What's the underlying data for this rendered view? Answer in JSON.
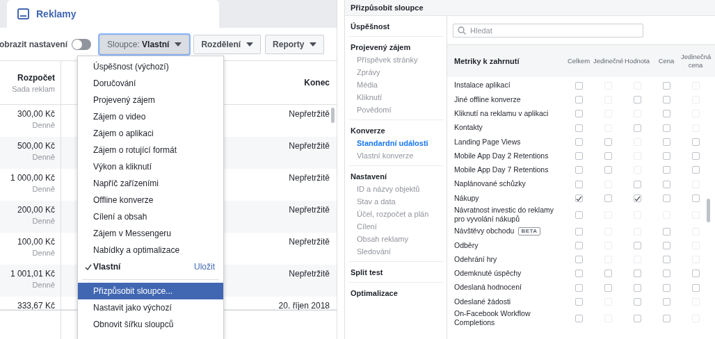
{
  "ads_panel": {
    "tab": {
      "label": "Reklamy"
    },
    "toolbar": {
      "settings_label": "obrazit nastavení",
      "settings_on": false,
      "buttons": [
        {
          "label": "Sloupce: **Vlastní**",
          "selected": true
        },
        {
          "label": "Rozdělení",
          "selected": false
        },
        {
          "label": "Reporty",
          "selected": false
        }
      ]
    },
    "table": {
      "columns": [
        {
          "title": "Rozpočet",
          "subtitle": "Sada reklam"
        },
        {
          "title": "Konec"
        }
      ],
      "rows": [
        {
          "budget": "300,00 Kč",
          "period": "Denně",
          "end": "Nepřetržitě"
        },
        {
          "budget": "500,00 Kč",
          "period": "Denně",
          "end": "Nepřetržitě"
        },
        {
          "budget": "1 000,00 Kč",
          "period": "Denně",
          "end": "Nepřetržitě"
        },
        {
          "budget": "200,00 Kč",
          "period": "Denně",
          "end": "Nepřetržitě"
        },
        {
          "budget": "100,00 Kč",
          "period": "Denně",
          "end": "Nepřetržitě"
        },
        {
          "budget": "1 001,01 Kč",
          "period": "Denně",
          "end": "Nepřetržitě"
        },
        {
          "budget": "333,67 Kč",
          "end": "20. říjen 2018"
        }
      ]
    },
    "menu": {
      "items": [
        {
          "kind": "preset",
          "label": "Úspěšnost (výchozí)",
          "checked": false,
          "selected": false
        },
        {
          "kind": "preset",
          "label": "Doručování",
          "checked": false,
          "selected": false
        },
        {
          "kind": "preset",
          "label": "Projevený zájem",
          "checked": false,
          "selected": false
        },
        {
          "kind": "preset",
          "label": "Zájem o video",
          "checked": false,
          "selected": false
        },
        {
          "kind": "preset",
          "label": "Zájem o aplikaci",
          "checked": false,
          "selected": false
        },
        {
          "kind": "preset",
          "label": "Zájem o rotující formát",
          "checked": false,
          "selected": false
        },
        {
          "kind": "preset",
          "label": "Výkon a kliknutí",
          "checked": false,
          "selected": false
        },
        {
          "kind": "preset",
          "label": "Napříč zařízeními",
          "checked": false,
          "selected": false
        },
        {
          "kind": "preset",
          "label": "Offline konverze",
          "checked": false,
          "selected": false
        },
        {
          "kind": "preset",
          "label": "Cílení a obsah",
          "checked": false,
          "selected": false
        },
        {
          "kind": "preset",
          "label": "Zájem v Messengeru",
          "checked": false,
          "selected": false
        },
        {
          "kind": "preset",
          "label": "Nabídky a optimalizace",
          "checked": false,
          "selected": false
        },
        {
          "kind": "custom",
          "label": "Vlastní",
          "action": "Uložit",
          "checked": true,
          "selected": false
        },
        {
          "kind": "action",
          "label": "Přizpůsobit sloupce...",
          "checked": false,
          "selected": true
        },
        {
          "kind": "action",
          "label": "Nastavit jako výchozí",
          "checked": false,
          "selected": false
        },
        {
          "kind": "action",
          "label": "Obnovit šířku sloupců",
          "checked": false,
          "selected": false
        }
      ]
    }
  },
  "dialog": {
    "title": "Přizpůsobit sloupce",
    "sidebar": [
      {
        "label": "Úspěšnost"
      },
      {
        "label": "Projevený zájem",
        "children": [
          {
            "label": "Příspěvek stránky",
            "selected": false
          },
          {
            "label": "Zprávy",
            "selected": false
          },
          {
            "label": "Média",
            "selected": false
          },
          {
            "label": "Kliknutí",
            "selected": false
          },
          {
            "label": "Povědomí",
            "selected": false
          }
        ]
      },
      {
        "label": "Konverze",
        "children": [
          {
            "label": "Standardní události",
            "selected": true
          },
          {
            "label": "Vlastní konverze",
            "selected": false
          }
        ]
      },
      {
        "label": "Nastavení",
        "children": [
          {
            "label": "ID a názvy objektů",
            "selected": false
          },
          {
            "label": "Stav a data",
            "selected": false
          },
          {
            "label": "Účel, rozpočet a plán",
            "selected": false
          },
          {
            "label": "Cílení",
            "selected": false
          },
          {
            "label": "Obsah reklamy",
            "selected": false
          },
          {
            "label": "Sledování",
            "selected": false
          }
        ]
      },
      {
        "label": "Split test"
      },
      {
        "label": "Optimalizace"
      }
    ],
    "search": {
      "placeholder": "Hledat"
    },
    "metrics": {
      "heading": "Metriky k zahrnutí",
      "columns": [
        "Celkem",
        "Jedinečné",
        "Hodnota",
        "Cena",
        "Jedinečná cena"
      ],
      "rows": [
        {
          "name": "Instalace aplikací",
          "cells": [
            {
              "checked": false,
              "disabled": false
            },
            {
              "checked": false,
              "disabled": true
            },
            {
              "checked": false,
              "disabled": true
            },
            {
              "checked": false,
              "disabled": false
            },
            {
              "checked": false,
              "disabled": true
            }
          ]
        },
        {
          "name": "Jiné offline konverze",
          "cells": [
            {
              "checked": false,
              "disabled": false
            },
            {
              "checked": false,
              "disabled": true
            },
            {
              "checked": false,
              "disabled": false
            },
            {
              "checked": false,
              "disabled": false
            },
            {
              "checked": false,
              "disabled": true
            }
          ]
        },
        {
          "name": "Kliknutí na reklamu v aplikaci",
          "cells": [
            {
              "checked": false,
              "disabled": false
            },
            {
              "checked": false,
              "disabled": true
            },
            {
              "checked": false,
              "disabled": true
            },
            {
              "checked": false,
              "disabled": false
            },
            {
              "checked": false,
              "disabled": true
            }
          ]
        },
        {
          "name": "Kontakty",
          "cells": [
            {
              "checked": false,
              "disabled": false
            },
            {
              "checked": false,
              "disabled": true
            },
            {
              "checked": false,
              "disabled": false
            },
            {
              "checked": false,
              "disabled": false
            },
            {
              "checked": false,
              "disabled": true
            }
          ]
        },
        {
          "name": "Landing Page Views",
          "cells": [
            {
              "checked": false,
              "disabled": false
            },
            {
              "checked": false,
              "disabled": false
            },
            {
              "checked": false,
              "disabled": true
            },
            {
              "checked": false,
              "disabled": false
            },
            {
              "checked": false,
              "disabled": false
            }
          ]
        },
        {
          "name": "Mobile App Day 2 Retentions",
          "cells": [
            {
              "checked": false,
              "disabled": false
            },
            {
              "checked": false,
              "disabled": false
            },
            {
              "checked": false,
              "disabled": true
            },
            {
              "checked": false,
              "disabled": false
            },
            {
              "checked": false,
              "disabled": false
            }
          ]
        },
        {
          "name": "Mobile App Day 7 Retentions",
          "cells": [
            {
              "checked": false,
              "disabled": false
            },
            {
              "checked": false,
              "disabled": false
            },
            {
              "checked": false,
              "disabled": true
            },
            {
              "checked": false,
              "disabled": false
            },
            {
              "checked": false,
              "disabled": false
            }
          ]
        },
        {
          "name": "Naplánované schůzky",
          "cells": [
            {
              "checked": false,
              "disabled": false
            },
            {
              "checked": false,
              "disabled": true
            },
            {
              "checked": false,
              "disabled": false
            },
            {
              "checked": false,
              "disabled": false
            },
            {
              "checked": false,
              "disabled": true
            }
          ]
        },
        {
          "name": "Nákupy",
          "cells": [
            {
              "checked": true,
              "disabled": false
            },
            {
              "checked": false,
              "disabled": false
            },
            {
              "checked": true,
              "disabled": false
            },
            {
              "checked": false,
              "disabled": false
            },
            {
              "checked": false,
              "disabled": false
            }
          ]
        },
        {
          "name": "Návratnost investic do reklamy pro vyvolání nákupů",
          "cells": [
            {
              "checked": false,
              "disabled": false
            },
            {
              "checked": false,
              "disabled": true
            },
            {
              "checked": false,
              "disabled": true
            },
            {
              "checked": false,
              "disabled": true
            },
            {
              "checked": false,
              "disabled": true
            }
          ]
        },
        {
          "name": "Návštěvy obchodu",
          "badge": "BETA",
          "cells": [
            {
              "checked": false,
              "disabled": false
            },
            {
              "checked": false,
              "disabled": true
            },
            {
              "checked": false,
              "disabled": true
            },
            {
              "checked": false,
              "disabled": false
            },
            {
              "checked": false,
              "disabled": true
            }
          ]
        },
        {
          "name": "Odběry",
          "cells": [
            {
              "checked": false,
              "disabled": false
            },
            {
              "checked": false,
              "disabled": true
            },
            {
              "checked": false,
              "disabled": false
            },
            {
              "checked": false,
              "disabled": false
            },
            {
              "checked": false,
              "disabled": true
            }
          ]
        },
        {
          "name": "Odehrání hry",
          "cells": [
            {
              "checked": false,
              "disabled": false
            },
            {
              "checked": false,
              "disabled": true
            },
            {
              "checked": false,
              "disabled": true
            },
            {
              "checked": false,
              "disabled": false
            },
            {
              "checked": false,
              "disabled": true
            }
          ]
        },
        {
          "name": "Odemknuté úspěchy",
          "cells": [
            {
              "checked": false,
              "disabled": false
            },
            {
              "checked": false,
              "disabled": false
            },
            {
              "checked": false,
              "disabled": false
            },
            {
              "checked": false,
              "disabled": false
            },
            {
              "checked": false,
              "disabled": false
            }
          ]
        },
        {
          "name": "Odeslaná hodnocení",
          "cells": [
            {
              "checked": false,
              "disabled": false
            },
            {
              "checked": false,
              "disabled": false
            },
            {
              "checked": false,
              "disabled": false
            },
            {
              "checked": false,
              "disabled": false
            },
            {
              "checked": false,
              "disabled": false
            }
          ]
        },
        {
          "name": "Odeslané žádosti",
          "cells": [
            {
              "checked": false,
              "disabled": false
            },
            {
              "checked": false,
              "disabled": true
            },
            {
              "checked": false,
              "disabled": false
            },
            {
              "checked": false,
              "disabled": false
            },
            {
              "checked": false,
              "disabled": true
            }
          ]
        },
        {
          "name": "On-Facebook Workflow Completions",
          "cells": [
            {
              "checked": false,
              "disabled": false
            },
            {
              "checked": false,
              "disabled": true
            },
            {
              "checked": false,
              "disabled": false
            },
            {
              "checked": false,
              "disabled": false
            },
            {
              "checked": false,
              "disabled": true
            }
          ]
        }
      ]
    }
  }
}
